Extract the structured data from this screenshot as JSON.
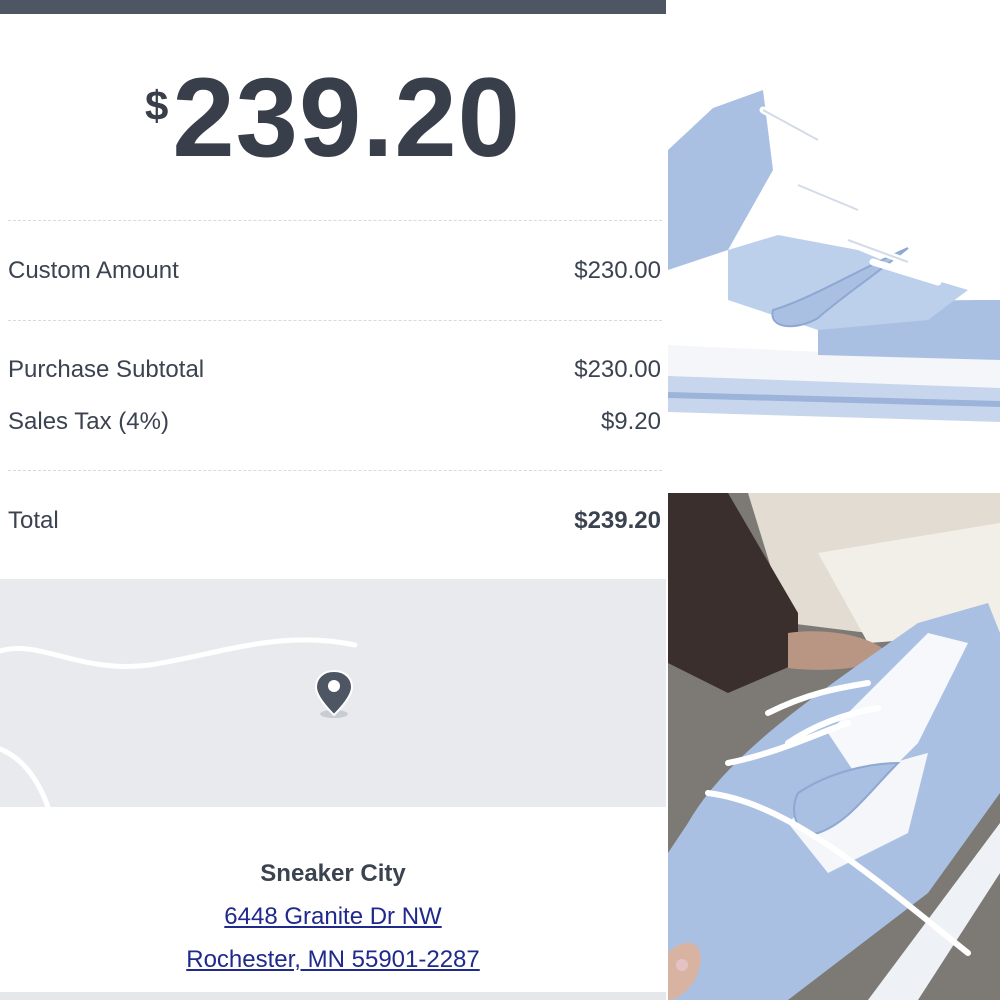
{
  "receipt": {
    "total_currency": "$",
    "total_amount": "239.20",
    "line_items": [
      {
        "label": "Custom Amount",
        "value": "$230.00"
      }
    ],
    "subtotal": {
      "label": "Purchase Subtotal",
      "value": "$230.00"
    },
    "tax": {
      "label": "Sales Tax (4%)",
      "value": "$9.20"
    },
    "total": {
      "label": "Total",
      "value": "$239.20"
    },
    "store": {
      "name": "Sneaker City",
      "address_line1": "6448 Granite Dr NW",
      "address_line2": "Rochester, MN 55901-2287"
    }
  },
  "icons": {
    "map_pin": "map-pin-icon"
  },
  "colors": {
    "top_bar": "#4e5664",
    "text_dark": "#383f4b",
    "link": "#1f2a8c",
    "map_bg": "#e9eaed",
    "sneaker_blue": "#a9c0e3"
  }
}
